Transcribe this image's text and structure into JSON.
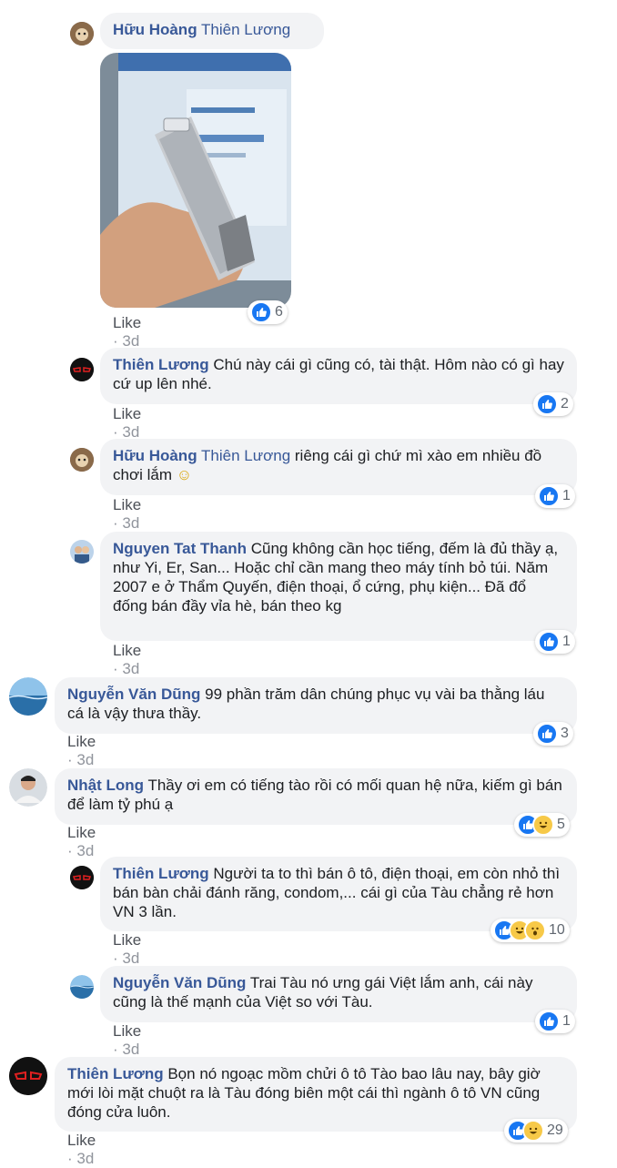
{
  "like_label": "Like",
  "comments": [
    {
      "author": "Hữu Hoàng",
      "mention": "Thiên Lương",
      "text": "",
      "time": "3d",
      "reactions": [
        "like"
      ],
      "count": "6",
      "avatar": "monkey-avatar"
    },
    {
      "author": "Thiên Lương",
      "mention": "",
      "text": "Chú này cái gì cũng có, tài thật. Hôm nào có gì hay cứ up lên nhé.",
      "time": "3d",
      "reactions": [
        "like"
      ],
      "count": "2",
      "avatar": "red-glasses-avatar"
    },
    {
      "author": "Hữu Hoàng",
      "mention": "Thiên Lương",
      "text": "riêng cái gì chứ mì xào em nhiều đồ chơi lắm",
      "emoji": "☺",
      "time": "3d",
      "reactions": [
        "like"
      ],
      "count": "1",
      "avatar": "monkey-avatar"
    },
    {
      "author": "Nguyen Tat Thanh",
      "mention": "",
      "text": "Cũng không cần học tiếng, đếm là đủ thầy ạ, như Yi, Er, San... Hoặc chỉ cần mang theo máy tính bỏ túi. Năm 2007 e ở Thẩm Quyến, điện thoại, ổ cứng, phụ kiện... Đã đổ đống bán đầy vỉa hè, bán theo kg",
      "time": "3d",
      "reactions": [
        "like"
      ],
      "count": "1",
      "avatar": "people-avatar"
    },
    {
      "author": "Nguyễn Văn Dũng",
      "mention": "",
      "text": "99 phần trăm dân chúng phục vụ vài ba thằng láu cá là vậy thưa thầy.",
      "time": "3d",
      "reactions": [
        "like"
      ],
      "count": "3",
      "avatar": "ocean-avatar"
    },
    {
      "author": "Nhật Long",
      "mention": "",
      "text": "Thầy ơi em có tiếng tào rồi có mối quan hệ nữa, kiếm gì bán để làm tỷ phú ạ",
      "time": "3d",
      "reactions": [
        "like",
        "haha"
      ],
      "count": "5",
      "avatar": "person-avatar"
    },
    {
      "author": "Thiên Lương",
      "mention": "",
      "text": "Người ta to thì bán ô tô, điện thoại, em còn nhỏ thì bán bàn chải đánh răng, condom,... cái gì của Tàu chẳng rẻ hơn VN 3 lần.",
      "time": "3d",
      "reactions": [
        "like",
        "haha",
        "wow"
      ],
      "count": "10",
      "avatar": "red-glasses-avatar"
    },
    {
      "author": "Nguyễn Văn Dũng",
      "mention": "",
      "text": "Trai Tàu nó ưng gái Việt lắm anh, cái này cũng là thế mạnh của Việt so với Tàu.",
      "time": "3d",
      "reactions": [
        "like"
      ],
      "count": "1",
      "avatar": "ocean-avatar"
    },
    {
      "author": "Thiên Lương",
      "mention": "",
      "text": "Bọn nó ngoạc mồm chửi ô tô Tào bao lâu nay, bây giờ mới lòi mặt chuột ra là Tàu đóng biên một cái thì ngành ô tô VN cũng đóng cửa luôn.",
      "time": "3d",
      "reactions": [
        "like",
        "haha"
      ],
      "count": "29",
      "avatar": "red-glasses-avatar"
    }
  ]
}
